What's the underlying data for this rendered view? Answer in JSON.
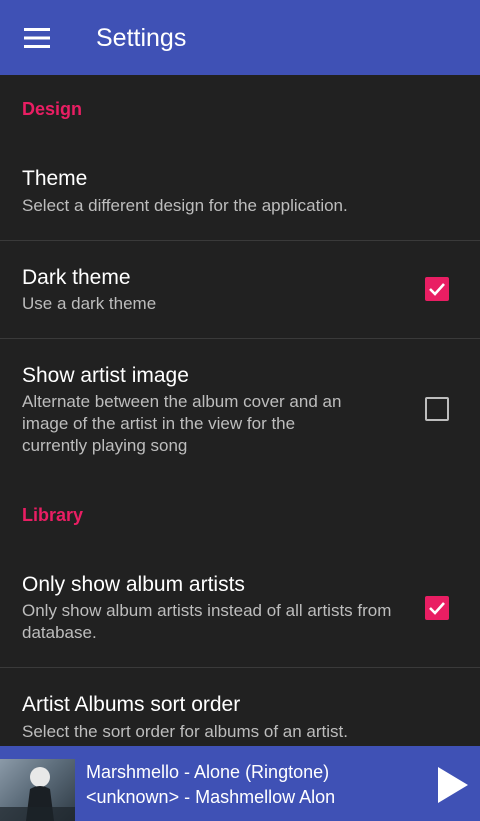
{
  "appbar": {
    "title": "Settings",
    "menu_icon": "hamburger-menu-icon"
  },
  "categories": {
    "design": "Design",
    "library": "Library"
  },
  "prefs": {
    "theme": {
      "title": "Theme",
      "summary": "Select a different design for the application."
    },
    "dark_theme": {
      "title": "Dark theme",
      "summary": "Use a dark theme",
      "checked": true
    },
    "artist_image": {
      "title": "Show artist image",
      "summary": "Alternate between the album cover and an image of the artist in the view for the currently playing song",
      "checked": false
    },
    "album_artists": {
      "title": "Only show album artists",
      "summary": "Only show album artists instead of all artists from database.",
      "checked": true
    },
    "sort_order": {
      "title": "Artist Albums sort order",
      "summary": "Select the sort order for albums of an artist."
    }
  },
  "player": {
    "title": "Marshmello - Alone (Ringtone)",
    "subtitle": "<unknown> - Mashmellow Alon",
    "play_icon": "play-icon"
  },
  "colors": {
    "primary": "#3f51b5",
    "accent": "#e91e63",
    "background": "#212121"
  }
}
